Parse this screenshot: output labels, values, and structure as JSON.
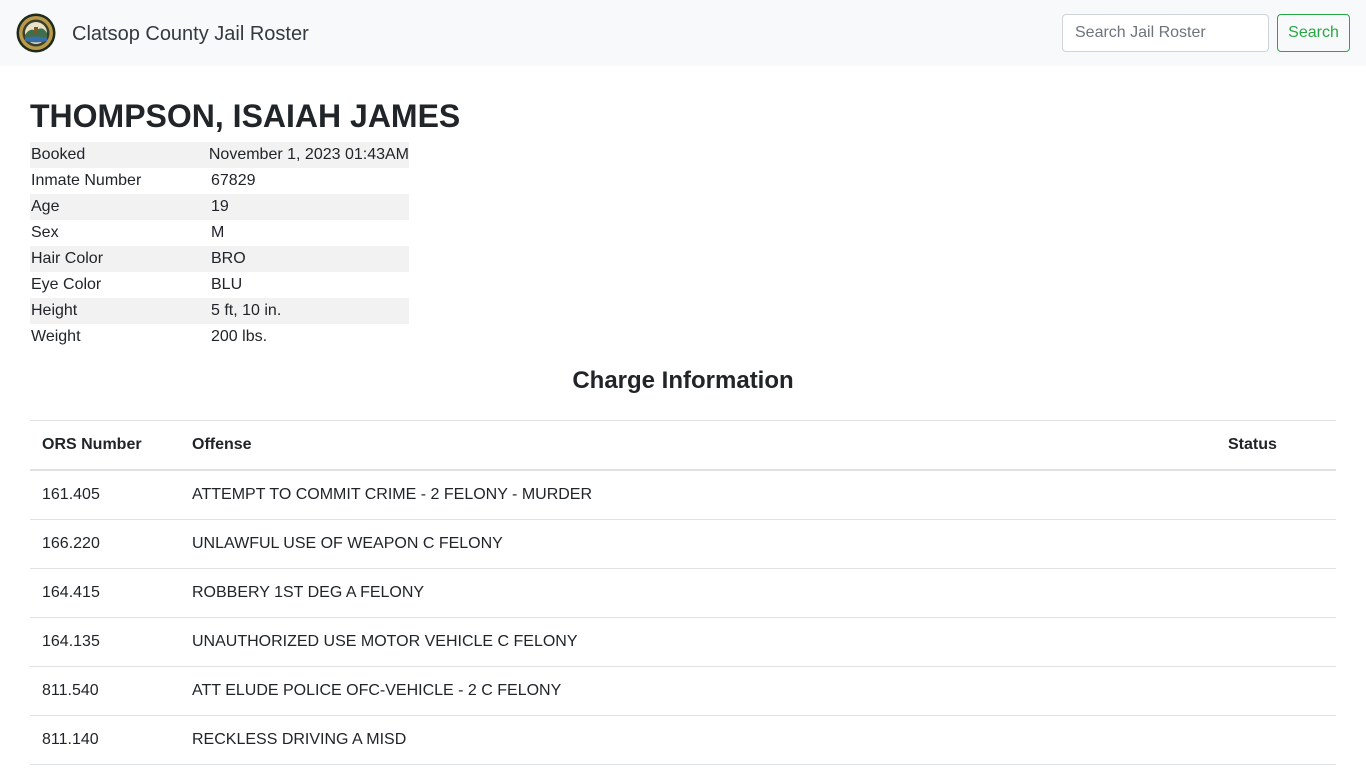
{
  "navbar": {
    "brand": "Clatsop County Jail Roster",
    "search_placeholder": "Search Jail Roster",
    "search_button": "Search"
  },
  "inmate": {
    "name": "THOMPSON, ISAIAH JAMES",
    "details": [
      {
        "label": "Booked",
        "value": "November 1, 2023 01:43AM"
      },
      {
        "label": "Inmate Number",
        "value": "67829"
      },
      {
        "label": "Age",
        "value": "19"
      },
      {
        "label": "Sex",
        "value": "M"
      },
      {
        "label": "Hair Color",
        "value": "BRO"
      },
      {
        "label": "Eye Color",
        "value": "BLU"
      },
      {
        "label": "Height",
        "value": "5 ft, 10 in."
      },
      {
        "label": "Weight",
        "value": "200 lbs."
      }
    ]
  },
  "charges": {
    "heading": "Charge Information",
    "columns": {
      "ors": "ORS Number",
      "offense": "Offense",
      "status": "Status"
    },
    "rows": [
      {
        "ors": "161.405",
        "offense": "ATTEMPT TO COMMIT CRIME - 2 FELONY - MURDER",
        "status": ""
      },
      {
        "ors": "166.220",
        "offense": "UNLAWFUL USE OF WEAPON C FELONY",
        "status": ""
      },
      {
        "ors": "164.415",
        "offense": "ROBBERY 1ST DEG A FELONY",
        "status": ""
      },
      {
        "ors": "164.135",
        "offense": "UNAUTHORIZED USE MOTOR VEHICLE C FELONY",
        "status": ""
      },
      {
        "ors": "811.540",
        "offense": "ATT ELUDE POLICE OFC-VEHICLE - 2 C FELONY",
        "status": ""
      },
      {
        "ors": "811.140",
        "offense": "RECKLESS DRIVING A MISD",
        "status": ""
      }
    ]
  },
  "colors": {
    "navbar_bg": "#f8f9fa",
    "accent_green": "#28a745",
    "stripe": "#f2f2f2",
    "border": "#dee2e6"
  },
  "icons": {
    "logo": "county-seal-icon"
  }
}
